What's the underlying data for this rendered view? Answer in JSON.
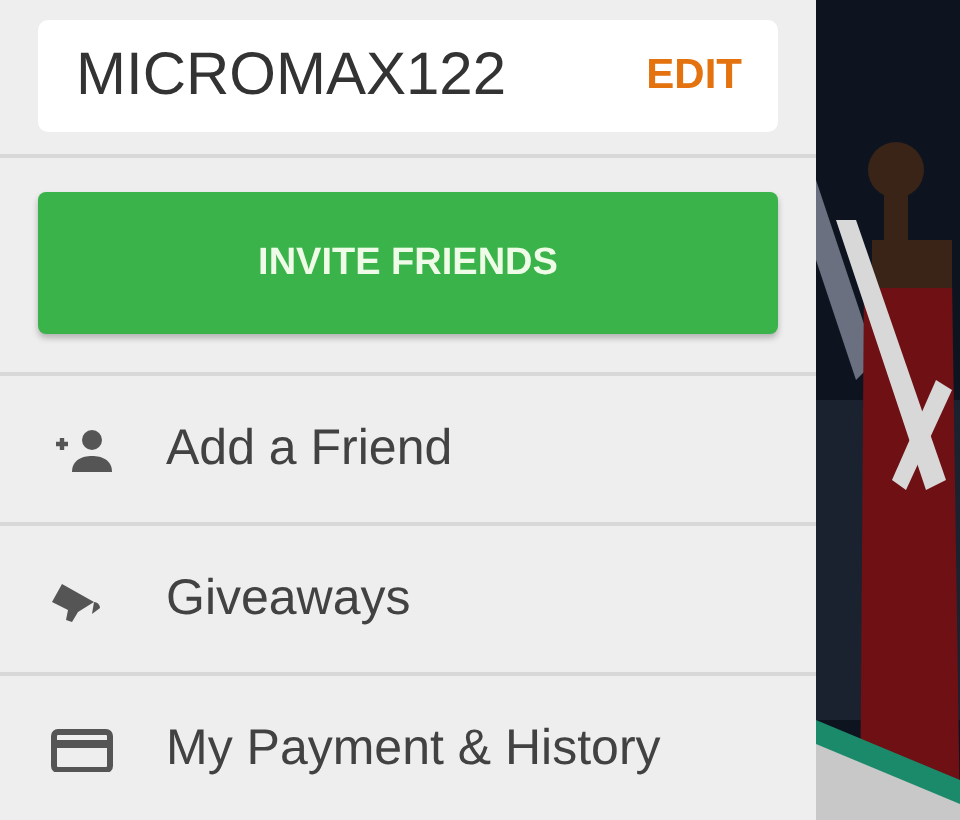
{
  "profile": {
    "username": "MICROMAX122",
    "edit_label": "EDIT"
  },
  "invite_button": "INVITE FRIENDS",
  "menu": [
    {
      "kind": "add-person",
      "label": "Add a Friend"
    },
    {
      "kind": "megaphone",
      "label": "Giveaways"
    },
    {
      "kind": "card",
      "label": "My Payment & History"
    }
  ]
}
